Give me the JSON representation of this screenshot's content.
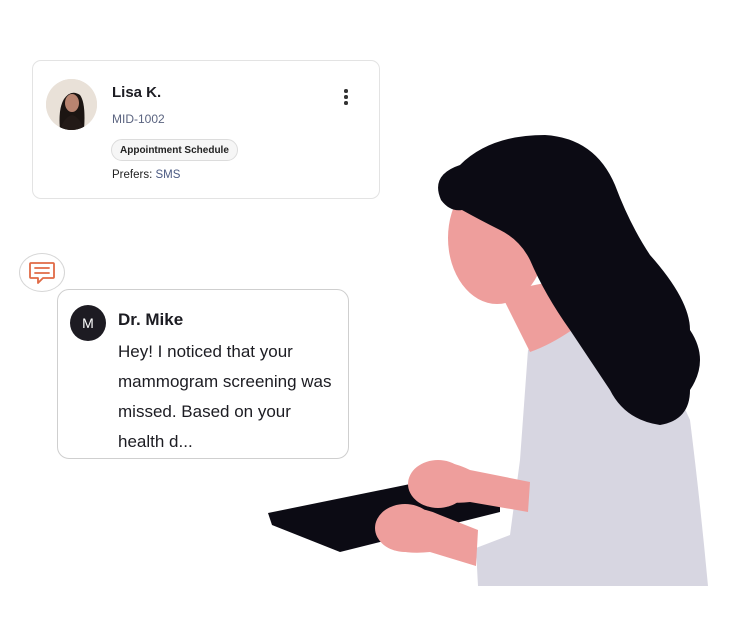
{
  "patient": {
    "name": "Lisa K.",
    "id": "MID-1002",
    "tag": "Appointment Schedule",
    "prefers_label": "Prefers:",
    "prefers_value": "SMS"
  },
  "message": {
    "avatar_initial": "M",
    "sender": "Dr. Mike",
    "text": "Hey! I noticed that your mammogram screening was missed. Based on your health d..."
  },
  "icons": {
    "kebab": "more-vertical-icon",
    "chat": "message-square-icon"
  },
  "colors": {
    "accent": "#e06a45",
    "text": "#1c1c22",
    "muted": "#5b6480",
    "hair": "#0c0b14",
    "skin": "#ee9e9c",
    "shirt": "#d7d6e1",
    "laptop": "#0c0b14"
  }
}
